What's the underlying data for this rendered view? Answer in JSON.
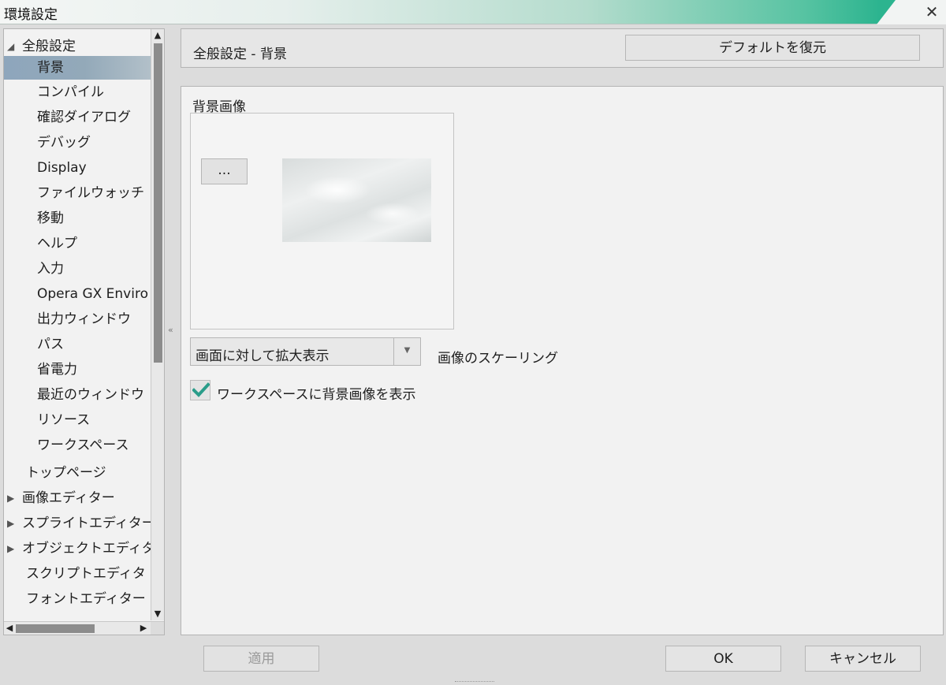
{
  "window": {
    "title": "環境設定",
    "close_glyph": "✕"
  },
  "tree": {
    "items": [
      {
        "label": "全般設定",
        "level": 0,
        "expander": "expanded"
      },
      {
        "label": "背景",
        "level": 1,
        "selected": true
      },
      {
        "label": "コンパイル",
        "level": 1
      },
      {
        "label": "確認ダイアログ",
        "level": 1
      },
      {
        "label": "デバッグ",
        "level": 1
      },
      {
        "label": "Display",
        "level": 1
      },
      {
        "label": "ファイルウォッチ",
        "level": 1
      },
      {
        "label": "移動",
        "level": 1
      },
      {
        "label": "ヘルプ",
        "level": 1
      },
      {
        "label": "入力",
        "level": 1
      },
      {
        "label": "Opera GX Enviro",
        "level": 1
      },
      {
        "label": "出力ウィンドウ",
        "level": 1
      },
      {
        "label": "パス",
        "level": 1
      },
      {
        "label": "省電力",
        "level": 1
      },
      {
        "label": "最近のウィンドウ",
        "level": 1
      },
      {
        "label": "リソース",
        "level": 1
      },
      {
        "label": "ワークスペース",
        "level": 1
      },
      {
        "label": "トップページ",
        "level": 0,
        "expander": "none"
      },
      {
        "label": "画像エディター",
        "level": 0,
        "expander": "collapsed"
      },
      {
        "label": "スプライトエディター",
        "level": 0,
        "expander": "collapsed"
      },
      {
        "label": "オブジェクトエディター",
        "level": 0,
        "expander": "collapsed"
      },
      {
        "label": "スクリプトエディタ",
        "level": 0,
        "expander": "none"
      },
      {
        "label": "フォントエディター",
        "level": 0,
        "expander": "none"
      }
    ]
  },
  "header": {
    "page_title": "全般設定 - 背景",
    "restore_label": "デフォルトを復元"
  },
  "content": {
    "background_image_label": "背景画像",
    "browse_label": "...",
    "scaling_value": "画面に対して拡大表示",
    "scaling_label": "画像のスケーリング",
    "show_bg_checked": true,
    "show_bg_label": "ワークスペースに背景画像を表示"
  },
  "footer": {
    "apply_label": "適用",
    "ok_label": "OK",
    "cancel_label": "キャンセル"
  },
  "colors": {
    "accent": "#2cb48f",
    "check": "#2a9d8a",
    "selection": "#93a9b9"
  }
}
